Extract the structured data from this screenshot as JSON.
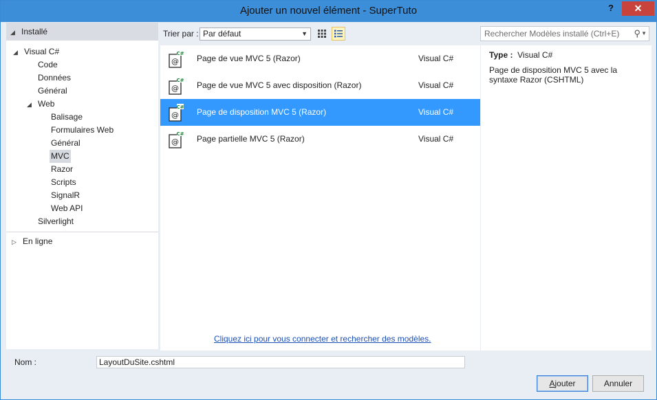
{
  "window": {
    "title": "Ajouter un nouvel élément - SuperTuto",
    "help": "?",
    "close": "✕"
  },
  "tree": {
    "installed": "Installé",
    "visual_csharp": "Visual C#",
    "code": "Code",
    "donnees": "Données",
    "general": "Général",
    "web": "Web",
    "web_items": [
      "Balisage",
      "Formulaires Web",
      "Général",
      "MVC",
      "Razor",
      "Scripts",
      "SignalR",
      "Web API"
    ],
    "silverlight": "Silverlight",
    "en_ligne": "En ligne",
    "selected": "MVC"
  },
  "toolbar": {
    "sort_label": "Trier par :",
    "sort_value": "Par défaut",
    "search_placeholder": "Rechercher Modèles installé (Ctrl+E)"
  },
  "templates": [
    {
      "name": "Page de vue MVC 5 (Razor)",
      "lang": "Visual C#",
      "selected": false
    },
    {
      "name": "Page de vue MVC 5 avec disposition (Razor)",
      "lang": "Visual C#",
      "selected": false
    },
    {
      "name": "Page de disposition MVC 5 (Razor)",
      "lang": "Visual C#",
      "selected": true
    },
    {
      "name": "Page partielle MVC 5 (Razor)",
      "lang": "Visual C#",
      "selected": false
    }
  ],
  "online_link": "Cliquez ici pour vous connecter et rechercher des modèles.",
  "description": {
    "type_label": "Type :",
    "type_value": "Visual C#",
    "text": "Page de disposition MVC 5 avec la syntaxe Razor (CSHTML)"
  },
  "bottom": {
    "name_label": "Nom :",
    "name_value": "LayoutDuSite.cshtml",
    "add_access": "A",
    "add_rest": "jouter",
    "cancel": "Annuler"
  },
  "colors": {
    "title_bar": "#3c8ed8",
    "selection": "#3399ff",
    "close": "#c7433c"
  }
}
